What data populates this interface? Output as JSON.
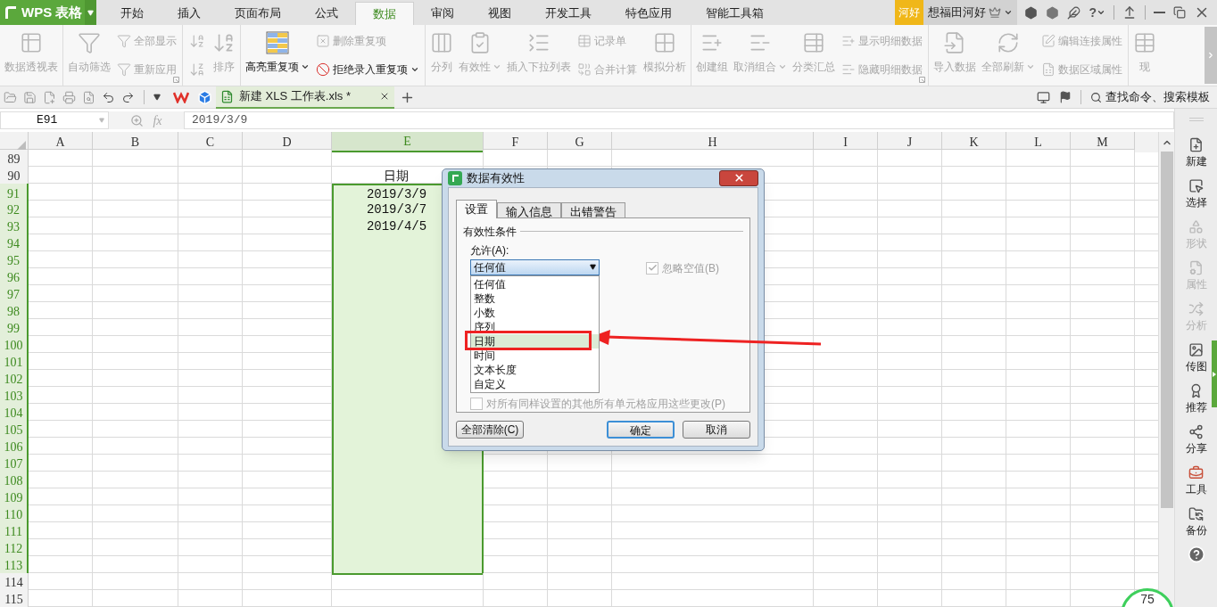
{
  "app": {
    "logo": "WPS 表格"
  },
  "menu_tabs": [
    {
      "label": "开始",
      "selected": false
    },
    {
      "label": "插入",
      "selected": false
    },
    {
      "label": "页面布局",
      "selected": false
    },
    {
      "label": "公式",
      "selected": false
    },
    {
      "label": "数据",
      "selected": true
    },
    {
      "label": "审阅",
      "selected": false
    },
    {
      "label": "视图",
      "selected": false
    },
    {
      "label": "开发工具",
      "selected": false
    },
    {
      "label": "特色应用",
      "selected": false
    },
    {
      "label": "智能工具箱",
      "selected": false
    }
  ],
  "account": {
    "badge": "河好",
    "name": "想福田河好",
    "help": "?"
  },
  "ribbon": {
    "groups": [
      {
        "items": [
          {
            "kind": "large",
            "label": "数据透视表",
            "disabled": true,
            "dropdown": false
          }
        ]
      },
      {
        "launcher": true,
        "items": [
          {
            "kind": "large",
            "label": "自动筛选",
            "disabled": true,
            "dropdown": false
          },
          {
            "kind": "stack",
            "items": [
              {
                "kind": "small",
                "label": "全部显示",
                "disabled": true,
                "dropdown": false
              },
              {
                "kind": "small",
                "label": "重新应用",
                "disabled": true,
                "dropdown": false
              }
            ]
          }
        ]
      },
      {
        "items": [
          {
            "kind": "stack",
            "items": [
              {
                "kind": "icon",
                "disabled": true,
                "dropdown": false
              },
              {
                "kind": "icon",
                "disabled": true,
                "dropdown": false
              }
            ]
          },
          {
            "kind": "large",
            "label": "排序",
            "disabled": true,
            "dropdown": false
          }
        ]
      },
      {
        "items": [
          {
            "kind": "large",
            "label": "高亮重复项",
            "disabled": false,
            "dropdown": true
          },
          {
            "kind": "stack",
            "items": [
              {
                "kind": "small",
                "label": "删除重复项",
                "disabled": true,
                "dropdown": false
              },
              {
                "kind": "small",
                "label": "拒绝录入重复项",
                "disabled": false,
                "dropdown": true
              }
            ]
          }
        ]
      },
      {
        "items": [
          {
            "kind": "large",
            "label": "分列",
            "disabled": true,
            "dropdown": false
          },
          {
            "kind": "large",
            "label": "有效性",
            "disabled": true,
            "dropdown": true
          },
          {
            "kind": "large",
            "label": "插入下拉列表",
            "disabled": true,
            "dropdown": false
          },
          {
            "kind": "stack",
            "items": [
              {
                "kind": "small",
                "label": "记录单",
                "disabled": true,
                "dropdown": false
              },
              {
                "kind": "small",
                "label": "合并计算",
                "disabled": true,
                "dropdown": false
              }
            ]
          },
          {
            "kind": "large",
            "label": "模拟分析",
            "disabled": true,
            "dropdown": false
          }
        ]
      },
      {
        "launcher": true,
        "items": [
          {
            "kind": "large",
            "label": "创建组",
            "disabled": true,
            "dropdown": false
          },
          {
            "kind": "large",
            "label": "取消组合",
            "disabled": true,
            "dropdown": true
          },
          {
            "kind": "large",
            "label": "分类汇总",
            "disabled": true,
            "dropdown": false
          },
          {
            "kind": "stack",
            "items": [
              {
                "kind": "small",
                "label": "显示明细数据",
                "disabled": true,
                "dropdown": false
              },
              {
                "kind": "small",
                "label": "隐藏明细数据",
                "disabled": true,
                "dropdown": false
              }
            ]
          }
        ]
      },
      {
        "items": [
          {
            "kind": "large",
            "label": "导入数据",
            "disabled": true,
            "dropdown": false
          },
          {
            "kind": "large",
            "label": "全部刷新",
            "disabled": true,
            "dropdown": true
          },
          {
            "kind": "stack",
            "items": [
              {
                "kind": "small",
                "label": "编辑连接属性",
                "disabled": true,
                "dropdown": false
              },
              {
                "kind": "small",
                "label": "数据区域属性",
                "disabled": true,
                "dropdown": false
              }
            ]
          }
        ]
      },
      {
        "items": [
          {
            "kind": "large",
            "label": "现",
            "disabled": true,
            "dropdown": false
          }
        ]
      }
    ]
  },
  "doc_bar": {
    "document_tab": {
      "title": "新建 XLS 工作表.xls *",
      "selected": true
    },
    "search_label": "查找命令、搜索模板"
  },
  "formula_bar": {
    "name_box": "E91",
    "function_label": "fx",
    "value": "2019/3/9"
  },
  "sheet": {
    "columns": [
      {
        "label": "A",
        "selected": false
      },
      {
        "label": "B",
        "selected": false
      },
      {
        "label": "C",
        "selected": false
      },
      {
        "label": "D",
        "selected": false
      },
      {
        "label": "E",
        "selected": true
      },
      {
        "label": "F",
        "selected": false
      },
      {
        "label": "G",
        "selected": false
      },
      {
        "label": "H",
        "selected": false
      },
      {
        "label": "I",
        "selected": false
      },
      {
        "label": "J",
        "selected": false
      },
      {
        "label": "K",
        "selected": false
      },
      {
        "label": "L",
        "selected": false
      },
      {
        "label": "M",
        "selected": false
      }
    ],
    "rows": [
      {
        "label": "89",
        "selected": false
      },
      {
        "label": "90",
        "selected": false,
        "E": "日期"
      },
      {
        "label": "91",
        "selected": true,
        "E": "2019/3/9"
      },
      {
        "label": "92",
        "selected": true,
        "E": "2019/3/7"
      },
      {
        "label": "93",
        "selected": true,
        "E": "2019/4/5"
      },
      {
        "label": "94",
        "selected": true
      },
      {
        "label": "95",
        "selected": true
      },
      {
        "label": "96",
        "selected": true
      },
      {
        "label": "97",
        "selected": true
      },
      {
        "label": "98",
        "selected": true
      },
      {
        "label": "99",
        "selected": true
      },
      {
        "label": "100",
        "selected": true
      },
      {
        "label": "101",
        "selected": true
      },
      {
        "label": "102",
        "selected": true
      },
      {
        "label": "103",
        "selected": true
      },
      {
        "label": "104",
        "selected": true
      },
      {
        "label": "105",
        "selected": true
      },
      {
        "label": "106",
        "selected": true
      },
      {
        "label": "107",
        "selected": true
      },
      {
        "label": "108",
        "selected": true
      },
      {
        "label": "109",
        "selected": true
      },
      {
        "label": "110",
        "selected": true
      },
      {
        "label": "111",
        "selected": true
      },
      {
        "label": "112",
        "selected": true
      },
      {
        "label": "113",
        "selected": true
      },
      {
        "label": "114",
        "selected": false
      },
      {
        "label": "115",
        "selected": false
      }
    ]
  },
  "dialog": {
    "title": "数据有效性",
    "tabs": [
      {
        "label": "设置",
        "selected": true
      },
      {
        "label": "输入信息",
        "selected": false
      },
      {
        "label": "出错警告",
        "selected": false
      }
    ],
    "section": "有效性条件",
    "allow_label": "允许(A):",
    "allow_value": "任何值",
    "options": [
      {
        "label": "任何值",
        "selected": false
      },
      {
        "label": "整数",
        "selected": false
      },
      {
        "label": "小数",
        "selected": false
      },
      {
        "label": "序列",
        "selected": false
      },
      {
        "label": "日期",
        "selected": true
      },
      {
        "label": "时间",
        "selected": false
      },
      {
        "label": "文本长度",
        "selected": false
      },
      {
        "label": "自定义",
        "selected": false
      }
    ],
    "ignore_blank": {
      "label": "忽略空值(B)",
      "checked": true,
      "disabled": true
    },
    "apply_all": {
      "label": "对所有同样设置的其他所有单元格应用这些更改(P)",
      "checked": false,
      "disabled": true
    },
    "buttons": [
      {
        "label": "全部清除(C)",
        "default": false
      },
      {
        "label": "确定",
        "default": true
      },
      {
        "label": "取消",
        "default": false
      }
    ]
  },
  "sidebar": {
    "items": [
      {
        "label": "新建",
        "disabled": false
      },
      {
        "label": "选择",
        "disabled": false
      },
      {
        "label": "形状",
        "disabled": true
      },
      {
        "label": "属性",
        "disabled": true
      },
      {
        "label": "分析",
        "disabled": true
      },
      {
        "label": "传图",
        "disabled": false
      },
      {
        "label": "推荐",
        "disabled": false
      },
      {
        "label": "分享",
        "disabled": false
      },
      {
        "label": "工具",
        "disabled": false
      },
      {
        "label": "备份",
        "disabled": false
      }
    ]
  },
  "status_ball": {
    "text": "75"
  }
}
